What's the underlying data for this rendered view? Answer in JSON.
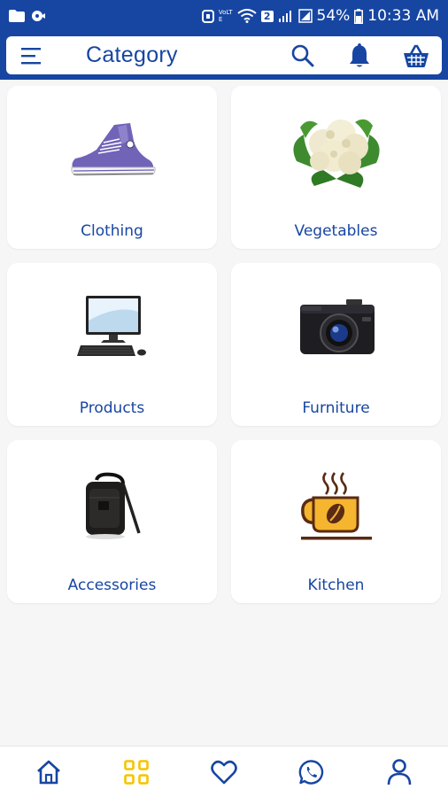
{
  "status_bar": {
    "battery": "54%",
    "time": "10:33 AM",
    "network_label": "VoLTE",
    "sim_badge": "2",
    "icons": [
      "folder-icon",
      "notification-icon",
      "alarm-icon",
      "wifi-icon",
      "signal-icon",
      "battery-icon"
    ]
  },
  "app_bar": {
    "title": "Category",
    "icons": [
      "menu-icon",
      "search-icon",
      "bell-icon",
      "basket-icon"
    ]
  },
  "categories": [
    {
      "label": "Clothing",
      "image": "sneaker-image"
    },
    {
      "label": "Vegetables",
      "image": "cauliflower-image"
    },
    {
      "label": "Products",
      "image": "desktop-computer-image"
    },
    {
      "label": "Furniture",
      "image": "camera-image"
    },
    {
      "label": "Accessories",
      "image": "bag-image"
    },
    {
      "label": "Kitchen",
      "image": "coffee-cup-icon"
    }
  ],
  "bottom_nav": {
    "items": [
      "home-icon",
      "categories-grid-icon",
      "heart-icon",
      "whatsapp-icon",
      "profile-icon"
    ],
    "active": "categories-grid-icon"
  },
  "colors": {
    "primary": "#1746a2",
    "active_nav": "#f5c400",
    "background": "#f6f6f6",
    "card": "#ffffff"
  }
}
